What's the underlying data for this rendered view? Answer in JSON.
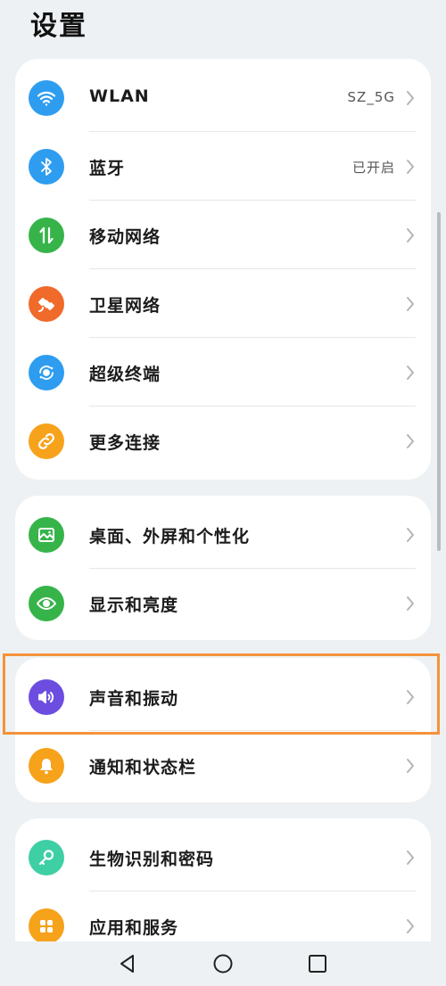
{
  "header": {
    "title": "设置"
  },
  "groups": [
    {
      "items": [
        {
          "label": "WLAN",
          "value": "SZ_5G",
          "icon": "wifi-icon",
          "color": "#2e9df0"
        },
        {
          "label": "蓝牙",
          "value": "已开启",
          "icon": "bluetooth-icon",
          "color": "#2e9df0"
        },
        {
          "label": "移动网络",
          "value": "",
          "icon": "mobile-data-icon",
          "color": "#36b44a"
        },
        {
          "label": "卫星网络",
          "value": "",
          "icon": "satellite-icon",
          "color": "#f06a2a"
        },
        {
          "label": "超级终端",
          "value": "",
          "icon": "super-device-icon",
          "color": "#2e9df0"
        },
        {
          "label": "更多连接",
          "value": "",
          "icon": "link-icon",
          "color": "#f7a21b"
        }
      ]
    },
    {
      "items": [
        {
          "label": "桌面、外屏和个性化",
          "value": "",
          "icon": "image-icon",
          "color": "#36b44a"
        },
        {
          "label": "显示和亮度",
          "value": "",
          "icon": "eye-icon",
          "color": "#36b44a"
        }
      ]
    },
    {
      "items": [
        {
          "label": "声音和振动",
          "value": "",
          "icon": "speaker-icon",
          "color": "#6c4de0"
        },
        {
          "label": "通知和状态栏",
          "value": "",
          "icon": "bell-icon",
          "color": "#f7a21b"
        }
      ]
    },
    {
      "items": [
        {
          "label": "生物识别和密码",
          "value": "",
          "icon": "key-icon",
          "color": "#3ecfa5"
        },
        {
          "label": "应用和服务",
          "value": "",
          "icon": "apps-icon",
          "color": "#f7a21b"
        }
      ]
    }
  ],
  "highlight_color": "#f5923a",
  "navbar": {
    "back": "back-icon",
    "home": "home-icon",
    "recents": "recents-icon"
  }
}
